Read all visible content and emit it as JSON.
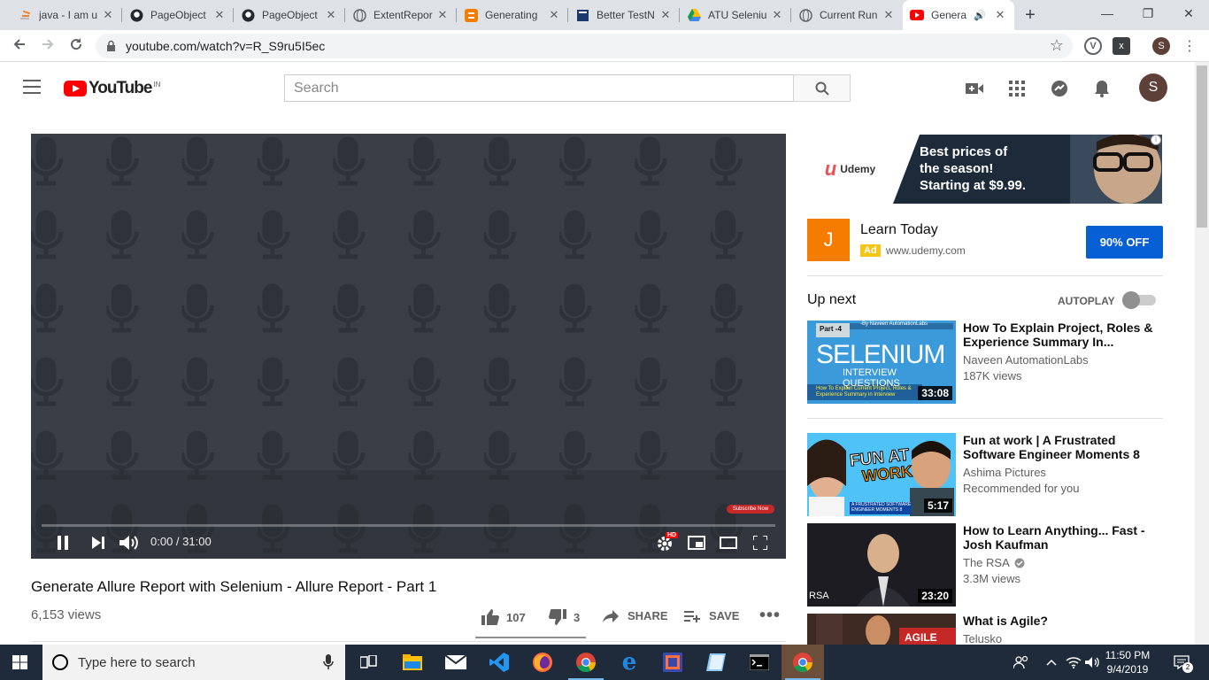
{
  "browser": {
    "tabs": [
      {
        "title": "java - I am u",
        "icon": "stackoverflow-icon"
      },
      {
        "title": "PageObject",
        "icon": "github-icon"
      },
      {
        "title": "PageObject",
        "icon": "github-icon"
      },
      {
        "title": "ExtentRepor",
        "icon": "globe-icon"
      },
      {
        "title": "Generating",
        "icon": "blogger-icon"
      },
      {
        "title": "Better TestN",
        "icon": "book-icon"
      },
      {
        "title": "ATU Seleniu",
        "icon": "drive-icon"
      },
      {
        "title": "Current Run",
        "icon": "globe-icon"
      },
      {
        "title": "Genera",
        "icon": "youtube-icon"
      }
    ],
    "url": "youtube.com/watch?v=R_S9ru5I5ec",
    "profile_initial": "S"
  },
  "youtube": {
    "region": "IN",
    "logo_text": "YouTube",
    "search_placeholder": "Search",
    "avatar_initial": "S"
  },
  "video": {
    "time": "0:00 / 31:00",
    "subscribe_overlay": "Subscribe Now",
    "hd_badge": "HD",
    "title": "Generate Allure Report with Selenium - Allure Report - Part 1",
    "views": "6,153 views",
    "likes": "107",
    "dislikes": "3",
    "share_label": "SHARE",
    "save_label": "SAVE"
  },
  "ad": {
    "banner_brand": "Udemy",
    "banner_line1": "Best prices of",
    "banner_line2": "the season!",
    "banner_line3": "Starting at $9.99.",
    "title": "Learn Today",
    "badge": "Ad",
    "url": "www.udemy.com",
    "cta": "90% OFF",
    "avatar_letter": "J"
  },
  "upnext": {
    "label": "Up next",
    "autoplay_label": "AUTOPLAY",
    "autoplay_on": false,
    "items": [
      {
        "title": "How To Explain Project, Roles & Experience Summary In...",
        "channel": "Naveen AutomationLabs",
        "meta": "187K views",
        "duration": "33:08",
        "thumb_tag": "Part -4",
        "thumb_top": "-By Naveen AutomationLabs",
        "thumb_main": "SELENIUM",
        "thumb_sub": "INTERVIEW QUESTIONS",
        "thumb_foot": "How To Explain Current Project, Roles & Experience Summary in Interview"
      },
      {
        "title": "Fun at work | A Frustrated Software Engineer Moments 8",
        "channel": "Ashima Pictures",
        "meta": "Recommended for you",
        "duration": "5:17",
        "thumb_main": "FUN AT",
        "thumb_sub": "WORK",
        "thumb_foot": "A FRUSTRATED SOFTWARE ENGINEER MOMENTS 8"
      },
      {
        "title": "How to Learn Anything... Fast - Josh Kaufman",
        "channel": "The RSA",
        "meta": "3.3M views",
        "duration": "23:20",
        "thumb_tag": "RSA"
      },
      {
        "title": "What is Agile?",
        "channel": "Telusko",
        "meta": "",
        "duration": "",
        "thumb_tag": "AGILE"
      }
    ]
  },
  "taskbar": {
    "search_placeholder": "Type here to search",
    "time": "11:50 PM",
    "date": "9/4/2019"
  },
  "colors": {
    "youtube_red": "#ff0000",
    "cta_blue": "#065fd4",
    "player_bg": "#3b3e47",
    "taskbar_bg": "#1f2b3a"
  }
}
